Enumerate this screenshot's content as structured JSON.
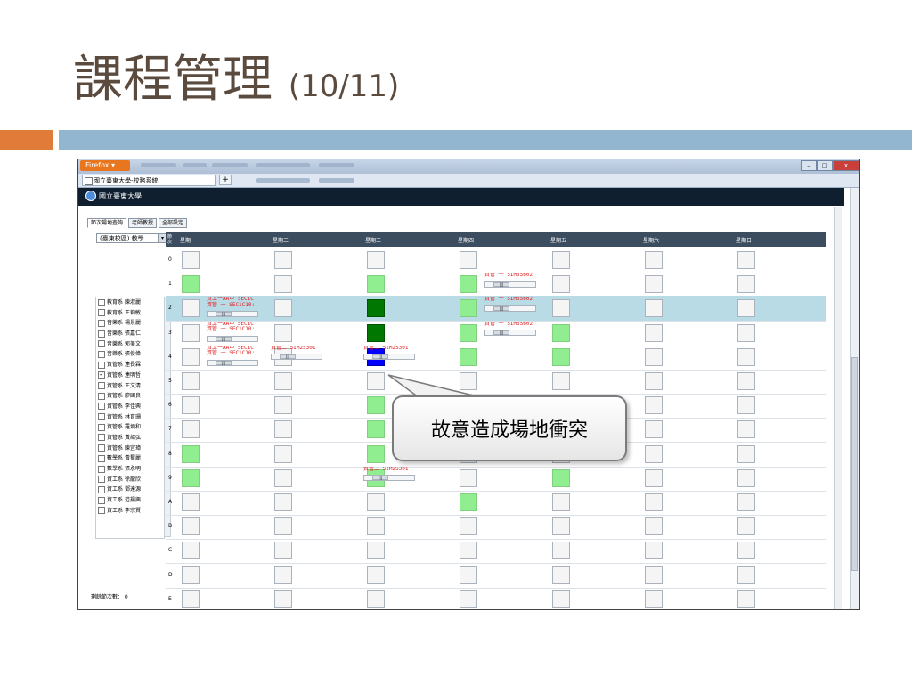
{
  "slide": {
    "title": "課程管理",
    "subtitle": "(10/11)"
  },
  "browser": {
    "menu_label": "Firefox ▾",
    "tab_title": "國立臺東大學-校務系統",
    "new_tab": "+",
    "win_min": "–",
    "win_max": "□",
    "win_close": "x",
    "logo_text": "國立臺東大學"
  },
  "tabs": [
    "節次場地查詢",
    "老師教授",
    "全部設定"
  ],
  "campus_combo": {
    "value": "(臺東校區) 教學",
    "arrow": "▾"
  },
  "days": [
    "星期一",
    "星期二",
    "星期三",
    "星期四",
    "星期五",
    "星期六",
    "星期日"
  ],
  "period_header": "節次",
  "periods": [
    "0",
    "1",
    "2",
    "3",
    "4",
    "5",
    "6",
    "7",
    "8",
    "9",
    "A",
    "B",
    "C",
    "D",
    "E"
  ],
  "teachers": [
    {
      "dept": "教育系",
      "name": "陳淑麗",
      "checked": false
    },
    {
      "dept": "教育系",
      "name": "王莉敏",
      "checked": false
    },
    {
      "dept": "音樂系",
      "name": "楊景麗",
      "checked": false
    },
    {
      "dept": "音樂系",
      "name": "張嘉仁",
      "checked": false
    },
    {
      "dept": "音樂系",
      "name": "郭美文",
      "checked": false
    },
    {
      "dept": "音樂系",
      "name": "張俊偉",
      "checked": false
    },
    {
      "dept": "資管系",
      "name": "連長霖",
      "checked": false
    },
    {
      "dept": "資管系",
      "name": "連明哲",
      "checked": true
    },
    {
      "dept": "資管系",
      "name": "王文清",
      "checked": false
    },
    {
      "dept": "資管系",
      "name": "廖國良",
      "checked": false
    },
    {
      "dept": "資管系",
      "name": "李佳興",
      "checked": false
    },
    {
      "dept": "資管系",
      "name": "林育珊",
      "checked": false
    },
    {
      "dept": "資管系",
      "name": "羅炳和",
      "checked": false
    },
    {
      "dept": "資管系",
      "name": "黃紹弘",
      "checked": false
    },
    {
      "dept": "資管系",
      "name": "陳宜璋",
      "checked": false
    },
    {
      "dept": "數學系",
      "name": "黃璽麗",
      "checked": false
    },
    {
      "dept": "數學系",
      "name": "張永明",
      "checked": false
    },
    {
      "dept": "資工系",
      "name": "徐龍欣",
      "checked": false
    },
    {
      "dept": "資工系",
      "name": "鄧達源",
      "checked": false
    },
    {
      "dept": "資工系",
      "name": "范揚興",
      "checked": false
    },
    {
      "dept": "資工系",
      "name": "李宗賢",
      "checked": false
    }
  ],
  "footer": {
    "remaining": "剩餘節次數： 0"
  },
  "cell_colors": {
    "1": [
      "lg",
      "",
      "lg",
      "lg",
      "",
      "",
      ""
    ],
    "2": [
      "",
      "",
      "dg",
      "lg",
      "",
      "",
      ""
    ],
    "3": [
      "",
      "",
      "dg",
      "lg",
      "lg",
      "",
      ""
    ],
    "4": [
      "",
      "",
      "bl",
      "lg",
      "lg",
      "",
      ""
    ],
    "5": [
      "",
      "",
      "",
      "",
      "",
      "",
      ""
    ],
    "6": [
      "",
      "",
      "lg",
      "",
      "",
      "",
      ""
    ],
    "7": [
      "",
      "",
      "lg",
      "",
      "",
      "",
      ""
    ],
    "8": [
      "lg",
      "",
      "lg",
      "",
      "",
      "",
      ""
    ],
    "9": [
      "lg",
      "",
      "lg",
      "",
      "lg",
      "",
      ""
    ],
    "10": [
      "",
      "",
      "",
      "lg",
      "",
      "",
      ""
    ]
  },
  "courses": [
    {
      "period": 1,
      "day": 3,
      "lines": [
        "資管 一 SIM3S602"
      ]
    },
    {
      "period": 2,
      "day": 0,
      "lines": [
        "資工一AA甲 SEC1C",
        "資管 一 SEC1C10:"
      ]
    },
    {
      "period": 2,
      "day": 3,
      "lines": [
        "資管 一 SIM3S602"
      ]
    },
    {
      "period": 3,
      "day": 0,
      "lines": [
        "資工一AA甲 SEC1C",
        "資管 一 SEC1C10:"
      ]
    },
    {
      "period": 3,
      "day": 3,
      "lines": [
        "資管 一 SIM3S602"
      ]
    },
    {
      "period": 4,
      "day": 0,
      "lines": [
        "資工一AA甲 SEC1C",
        "資管 一 SEC1C10:"
      ]
    },
    {
      "period": 4,
      "day": 1,
      "lines": [
        "資管二 SIM2S301"
      ]
    },
    {
      "period": 4,
      "day": 2,
      "lines": [
        "資管二 SIM2S301"
      ]
    },
    {
      "period": 9,
      "day": 2,
      "lines": [
        "資管二 SIM2S301"
      ]
    }
  ],
  "scroll_thumb_label": "|||",
  "callout": {
    "text": "故意造成場地衝突"
  }
}
